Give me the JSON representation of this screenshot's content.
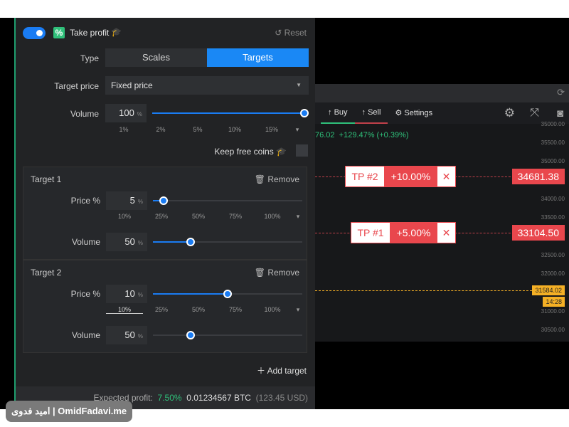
{
  "take_profit": {
    "enabled": true,
    "title": "Take profit",
    "reset": "Reset",
    "type_label": "Type",
    "type_options": [
      "Scales",
      "Targets"
    ],
    "type_selected": "Targets",
    "target_price_label": "Target price",
    "target_price_value": "Fixed price",
    "volume_label": "Volume",
    "volume_value": "100",
    "volume_pct": 100,
    "unit": "%",
    "volume_ticks": [
      "1%",
      "2%",
      "5%",
      "10%",
      "15%"
    ],
    "keep_free_coins": "Keep free coins",
    "keep_free_coins_checked": false
  },
  "targets": [
    {
      "title": "Target 1",
      "remove": "Remove",
      "price_label": "Price %",
      "price_value": "5",
      "price_slider_pct": 7,
      "ticks": [
        "10%",
        "25%",
        "50%",
        "75%",
        "100%"
      ],
      "volume_label": "Volume",
      "volume_value": "50",
      "volume_slider_pct": 25
    },
    {
      "title": "Target 2",
      "remove": "Remove",
      "price_label": "Price %",
      "price_value": "10",
      "price_slider_pct": 50,
      "ticks": [
        "10%",
        "25%",
        "50%",
        "75%",
        "100%"
      ],
      "volume_label": "Volume",
      "volume_value": "50",
      "volume_slider_pct": 25
    }
  ],
  "add_target": "Add target",
  "footer": {
    "label": "Expected profit:",
    "percent": "7.50%",
    "btc": "0.01234567 BTC",
    "usd": "(123.45 USD)"
  },
  "chart": {
    "buy": "Buy",
    "sell": "Sell",
    "settings": "Settings",
    "change": "76.02",
    "change_pct": "+129.47% (+0.39%)",
    "axis": [
      "35000.00",
      "35500.00",
      "35000.00",
      "34000.00",
      "33500.00",
      "32500.00",
      "32000.00",
      "31000.00",
      "30500.00"
    ],
    "tp2": {
      "label": "TP #2",
      "pct": "+10.00%",
      "price": "34681.38"
    },
    "tp1": {
      "label": "TP #1",
      "pct": "+5.00%",
      "price": "33104.50"
    },
    "current_price": "31584.02",
    "time": "14:28",
    "colors": {
      "green": "#2fc07a",
      "red": "#e9474d",
      "accent": "#1a88f5",
      "current": "#f5b025"
    }
  },
  "watermark": "امید فدوی | OmidFadavi.me"
}
